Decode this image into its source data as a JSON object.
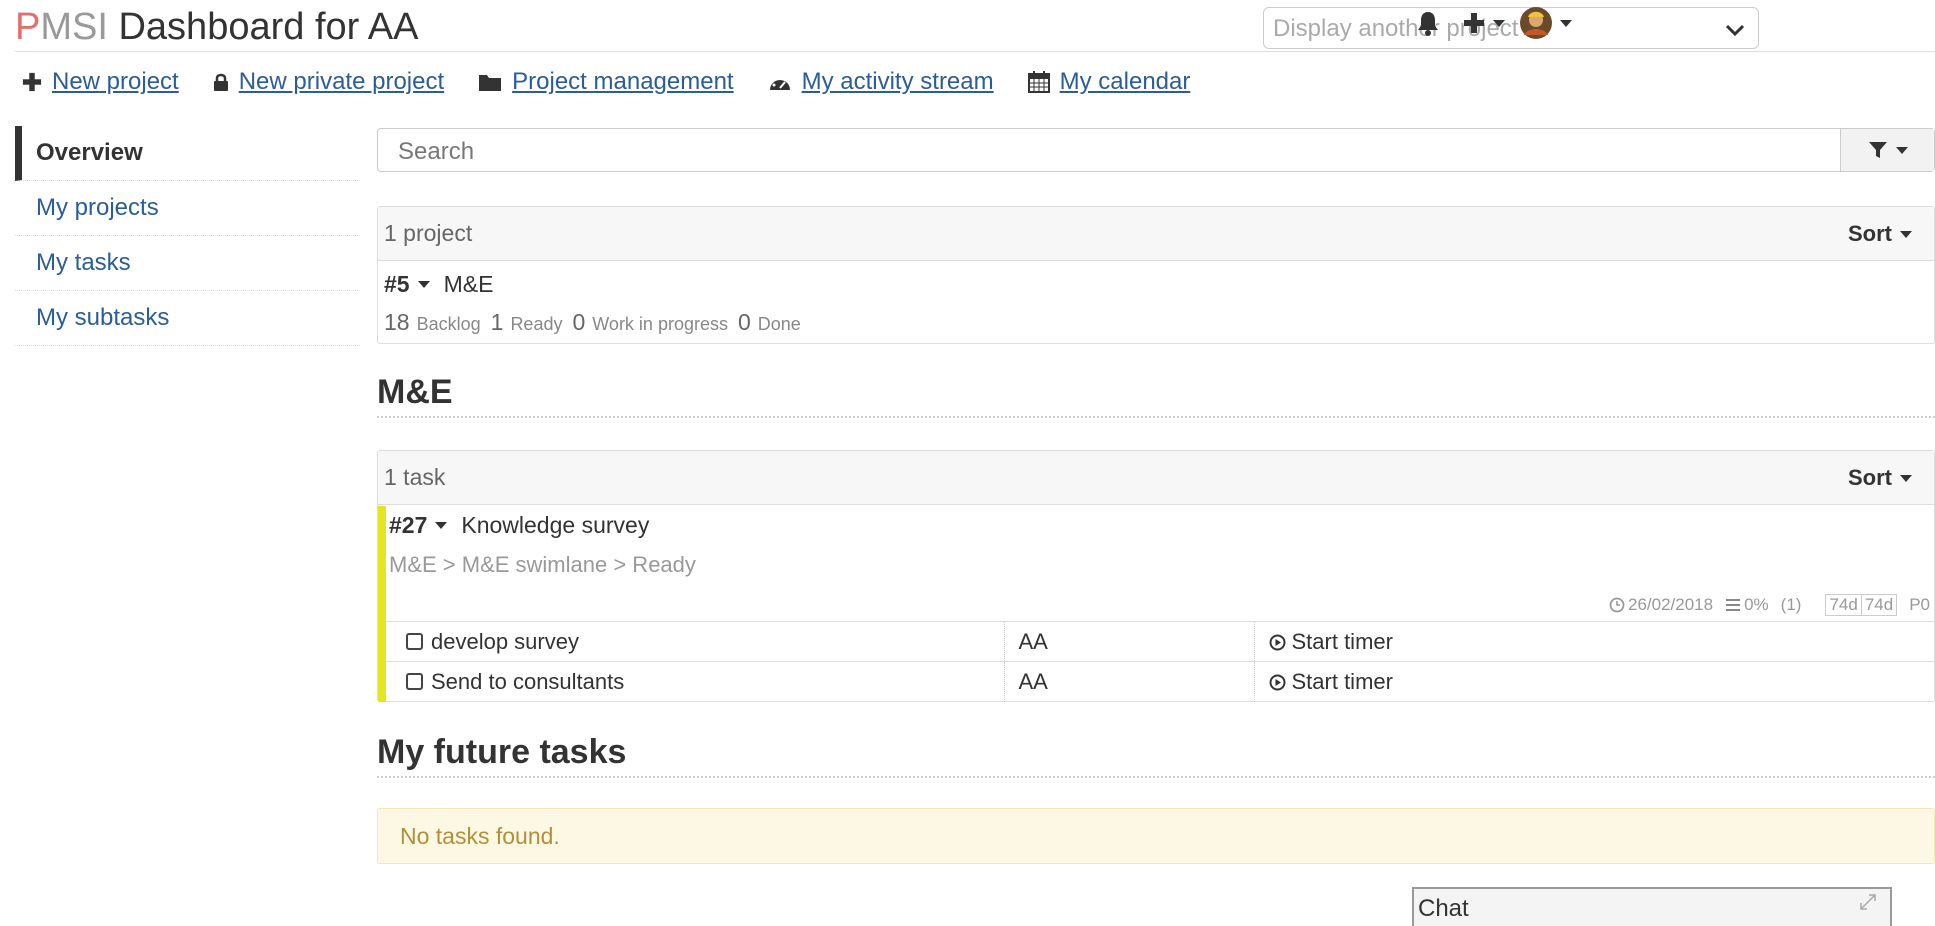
{
  "header": {
    "logo_p": "P",
    "logo_rest": "MSI",
    "title": "Dashboard for AA",
    "project_select_placeholder": "Display another project"
  },
  "actions": [
    {
      "label": "New project",
      "icon": "plus-icon"
    },
    {
      "label": "New private project",
      "icon": "lock-icon"
    },
    {
      "label": "Project management",
      "icon": "folder-icon"
    },
    {
      "label": "My activity stream",
      "icon": "dashboard-icon"
    },
    {
      "label": "My calendar",
      "icon": "calendar-icon"
    }
  ],
  "sidebar": {
    "items": [
      {
        "label": "Overview",
        "active": true
      },
      {
        "label": "My projects"
      },
      {
        "label": "My tasks"
      },
      {
        "label": "My subtasks"
      }
    ]
  },
  "search": {
    "placeholder": "Search"
  },
  "projects_panel": {
    "count": "1 project",
    "sort_label": "Sort",
    "project": {
      "id": "#5",
      "name": "M&E",
      "stats": [
        {
          "num": "18",
          "label": "Backlog"
        },
        {
          "num": "1",
          "label": "Ready"
        },
        {
          "num": "0",
          "label": "Work in progress"
        },
        {
          "num": "0",
          "label": "Done"
        }
      ]
    }
  },
  "project_section": {
    "title": "M&E",
    "count": "1 task",
    "sort_label": "Sort",
    "task": {
      "id": "#27",
      "title": "Knowledge survey",
      "path": "M&E > M&E swimlane > Ready",
      "date": "26/02/2018",
      "progress": "0%",
      "comments": "(1)",
      "time_spent": "74d",
      "time_estimated": "74d",
      "priority": "P0",
      "color": "#e6e620",
      "subtasks": [
        {
          "title": "develop survey",
          "assignee": "AA",
          "timer": "Start timer"
        },
        {
          "title": "Send to consultants",
          "assignee": "AA",
          "timer": "Start timer"
        }
      ]
    }
  },
  "future_tasks": {
    "title": "My future tasks",
    "empty_message": "No tasks found."
  },
  "chat": {
    "label": "Chat"
  }
}
